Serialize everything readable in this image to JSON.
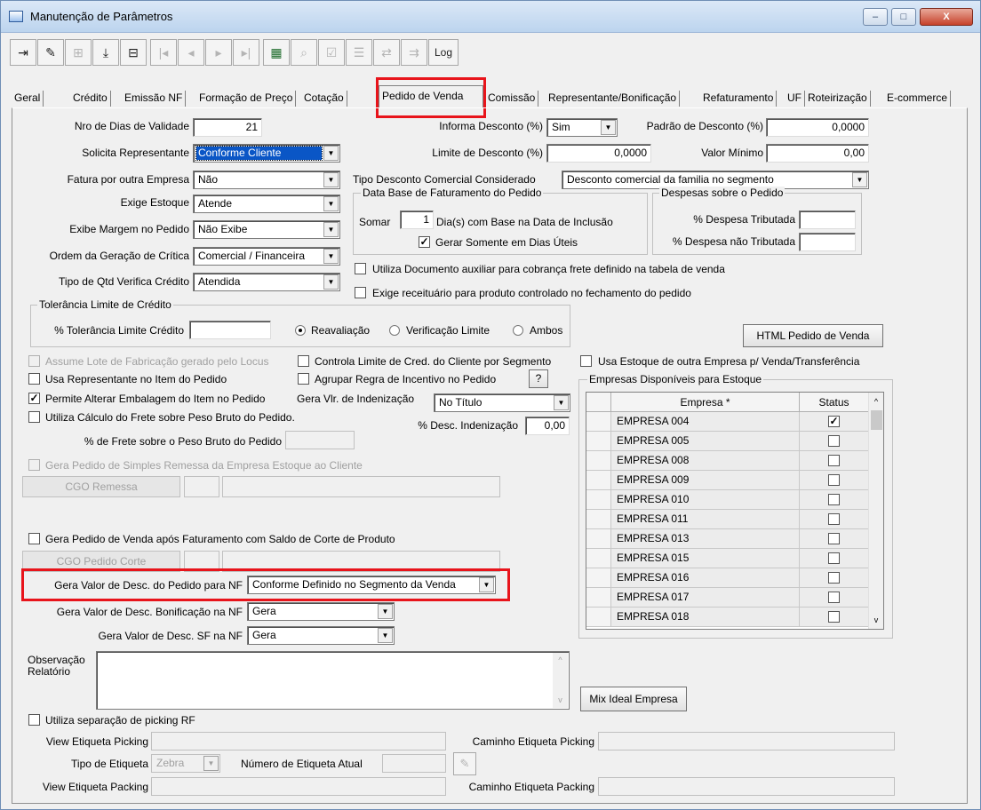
{
  "window": {
    "title": "Manutenção de Parâmetros",
    "minimize": "–",
    "maximize": "□",
    "close": "X"
  },
  "toolbar": {
    "log_label": "Log"
  },
  "tabs": [
    {
      "label": "Geral"
    },
    {
      "label": "Crédito"
    },
    {
      "label": "Emissão NF"
    },
    {
      "label": "Formação de Preço"
    },
    {
      "label": "Cotação"
    },
    {
      "label": "Pedido de Venda"
    },
    {
      "label": "Comissão"
    },
    {
      "label": "Representante/Bonificação"
    },
    {
      "label": "Refaturamento"
    },
    {
      "label": "UF"
    },
    {
      "label": "Roteirização"
    },
    {
      "label": "E-commerce"
    }
  ],
  "form": {
    "dias_validade_label": "Nro de Dias de Validade",
    "dias_validade": "21",
    "solicita_repr_label": "Solicita Representante",
    "solicita_repr": "Conforme Cliente",
    "fatura_outra_label": "Fatura por outra Empresa",
    "fatura_outra": "Não",
    "exige_estoque_label": "Exige Estoque",
    "exige_estoque": "Atende",
    "exibe_margem_label": "Exibe Margem no Pedido",
    "exibe_margem": "Não Exibe",
    "ordem_critica_label": "Ordem da Geração de Crítica",
    "ordem_critica": "Comercial / Financeira",
    "tipo_qtd_label": "Tipo de Qtd Verifica Crédito",
    "tipo_qtd": "Atendida",
    "informa_desc_label": "Informa Desconto (%)",
    "informa_desc": "Sim",
    "padrao_desc_label": "Padrão de Desconto (%)",
    "padrao_desc": "0,0000",
    "limite_desc_label": "Limite de Desconto (%)",
    "limite_desc": "0,0000",
    "valor_minimo_label": "Valor Mínimo",
    "valor_minimo": "0,00",
    "tipo_desc_com_label": "Tipo Desconto Comercial Considerado",
    "tipo_desc_com": "Desconto comercial da familia no segmento",
    "data_base_title": "Data Base de Faturamento do Pedido",
    "somar_label": "Somar",
    "somar_dias": "1",
    "somar_suffix": "Dia(s)  com Base na Data de Inclusão",
    "dias_uteis_label": "Gerar Somente em Dias Úteis",
    "despesas_title": "Despesas sobre o Pedido",
    "desp_trib_label": "% Despesa Tributada",
    "desp_nao_trib_label": "% Despesa não Tributada",
    "doc_aux_label": "Utiliza Documento auxiliar para cobrança frete definido na tabela de venda",
    "receituario_label": "Exige receituário para produto controlado no fechamento do pedido",
    "tolerancia_title": "Tolerância Limite de Crédito",
    "tolerancia_label": "% Tolerância Limite Crédito",
    "radio_reavaliacao": "Reavaliação",
    "radio_verificacao": "Verificação Limite",
    "radio_ambos": "Ambos",
    "html_pedido_btn": "HTML Pedido de Venda",
    "assume_lote_label": "Assume Lote de Fabricação gerado pelo Locus",
    "controla_limite_label": "Controla Limite de Cred. do Cliente por Segmento",
    "usa_estoque_outra_label": "Usa Estoque de outra Empresa p/ Venda/Transferência",
    "usa_repr_item_label": "Usa Representante no Item do Pedido",
    "agrupar_regra_label": "Agrupar Regra de Incentivo no Pedido",
    "help_btn": "?",
    "permite_embalagem_label": "Permite Alterar Embalagem do Item no Pedido",
    "gera_vlr_indeniz_label": "Gera Vlr. de Indenização",
    "gera_vlr_indeniz": "No Título",
    "calculo_frete_label": "Utiliza Cálculo do Frete sobre Peso Bruto do Pedido.",
    "desc_indeniz_label": "% Desc. Indenização",
    "desc_indeniz": "0,00",
    "frete_peso_label": "% de Frete sobre o Peso Bruto do Pedido",
    "simples_remessa_label": "Gera Pedido de Simples Remessa da Empresa Estoque ao Cliente",
    "cgo_remessa_btn": "CGO Remessa",
    "gera_apos_fat_label": "Gera Pedido de Venda após Faturamento com Saldo de Corte de Produto",
    "cgo_corte_btn": "CGO Pedido Corte",
    "gera_valor_desc_nf_label": "Gera Valor de Desc. do Pedido para NF",
    "gera_valor_desc_nf": "Conforme Definido no Segmento da Venda",
    "gera_valor_bonif_label": "Gera Valor de Desc. Bonificação na NF",
    "gera_valor_bonif": "Gera",
    "gera_valor_sf_label": "Gera Valor de Desc. SF na NF",
    "gera_valor_sf": "Gera",
    "observacao_label": "Observação",
    "relatorio_label": "Relatório",
    "mix_ideal_btn": "Mix Ideal Empresa",
    "picking_rf_label": "Utiliza separação de picking RF",
    "view_etq_picking_label": "View Etiqueta Picking",
    "caminho_etq_picking_label": "Caminho Etiqueta Picking",
    "tipo_etiqueta_label": "Tipo de Etiqueta",
    "tipo_etiqueta": "Zebra",
    "num_etiqueta_label": "Número de Etiqueta Atual",
    "view_etq_packing_label": "View Etiqueta Packing",
    "caminho_etq_packing_label": "Caminho Etiqueta Packing"
  },
  "empresas": {
    "title": "Empresas Disponíveis para Estoque",
    "col_empresa": "Empresa *",
    "col_status": "Status",
    "rows": [
      {
        "name": "EMPRESA 004",
        "checked": "✓"
      },
      {
        "name": "EMPRESA 005",
        "checked": ""
      },
      {
        "name": "EMPRESA 008",
        "checked": ""
      },
      {
        "name": "EMPRESA 009",
        "checked": ""
      },
      {
        "name": "EMPRESA 010",
        "checked": ""
      },
      {
        "name": "EMPRESA 011",
        "checked": ""
      },
      {
        "name": "EMPRESA 013",
        "checked": ""
      },
      {
        "name": "EMPRESA 015",
        "checked": ""
      },
      {
        "name": "EMPRESA 016",
        "checked": ""
      },
      {
        "name": "EMPRESA 017",
        "checked": ""
      },
      {
        "name": "EMPRESA 018",
        "checked": ""
      }
    ]
  },
  "glyphs": {
    "check": "✓",
    "dropdown": "▼",
    "up": "^",
    "down": "v"
  }
}
